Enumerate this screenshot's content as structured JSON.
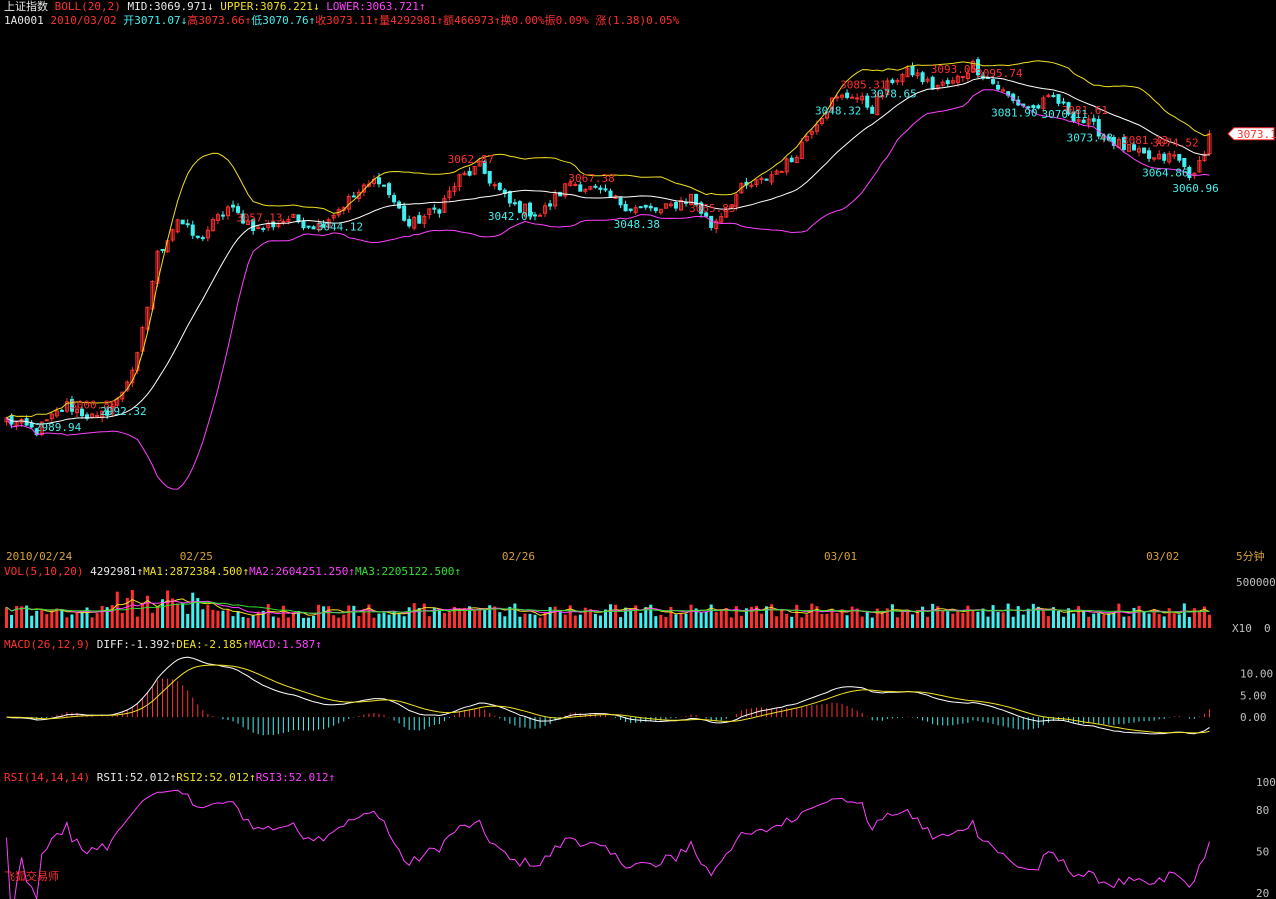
{
  "header": {
    "symbol_name": "上证指数",
    "boll_label": "BOLL(20,2)",
    "mid_text": "MID:3069.971",
    "upper_text": "UPPER:3076.221",
    "lower_text": "LOWER:3063.721",
    "code": "1A0001",
    "date": "2010/03/02",
    "open_text": "开3071.07",
    "high_text": "高3073.66",
    "low_text": "低3070.76",
    "close_text": "收3073.11",
    "volume_text": "量4292981",
    "amount_text": "额466973",
    "turnover_text": "换0.00%",
    "amplitude_text": "振0.09%",
    "change_text": "涨(1.38)0.05%"
  },
  "vol_header": {
    "label": "VOL(5,10,20)",
    "value": "4292981",
    "ma1": "MA1:2872384.500",
    "ma2": "MA2:2604251.250",
    "ma3": "MA3:2205122.500"
  },
  "macd_header": {
    "label": "MACD(26,12,9)",
    "diff": "DIFF:-1.392",
    "dea": "DEA:-2.185",
    "macd": "MACD:1.587"
  },
  "rsi_header": {
    "label": "RSI(14,14,14)",
    "rsi1": "RSI1:52.012",
    "rsi2": "RSI2:52.012",
    "rsi3": "RSI3:52.012"
  },
  "watermark": "飞狐交易师",
  "period_label": "5分钟",
  "current_price_tag": "3073.1",
  "colors": {
    "up": "#ff3030",
    "down": "#40f0f0",
    "mid": "#ffffff",
    "upper": "#f0e020",
    "lower": "#ff40ff",
    "ma3": "#30e030",
    "axis": "#c0c0c0",
    "date": "#d8a040"
  },
  "chart_data": [
    {
      "type": "candlestick",
      "indicator": "BOLL(20,2)",
      "ylim": [
        2960,
        3102
      ],
      "date_labels": [
        "2010/02/24",
        "02/25",
        "02/26",
        "03/01",
        "03/02"
      ],
      "high_annotations": [
        "3000.80",
        "3057.13",
        "3062.87",
        "3067.38",
        "3065.83",
        "3085.31",
        "3093.05",
        "3095.74",
        "3081.61",
        "3081.13",
        "3074.52"
      ],
      "low_annotations": [
        "2989.94",
        "2992.32",
        "3044.12",
        "3042.07",
        "3048.38",
        "3048.32",
        "3078.65",
        "3081.90",
        "3070.11",
        "3073.48",
        "3064.86",
        "3060.96"
      ],
      "last_close": 3073.11
    },
    {
      "type": "bar",
      "indicator": "VOL(5,10,20)",
      "y_ticks": [
        "500000",
        "0"
      ],
      "unit_label": "X10"
    },
    {
      "type": "bar",
      "indicator": "MACD(26,12,9)",
      "y_ticks": [
        "10.00",
        "5.00",
        "0.00"
      ]
    },
    {
      "type": "line",
      "indicator": "RSI(14,14,14)",
      "ylim": [
        20,
        100
      ],
      "y_ticks": [
        "100",
        "80",
        "50",
        "20"
      ]
    }
  ]
}
